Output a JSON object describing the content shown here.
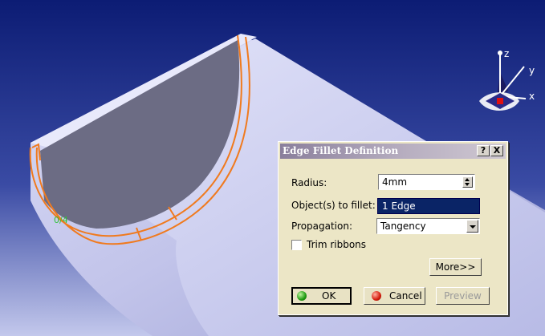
{
  "viewport": {
    "background_top": "#0d1f7a",
    "background_bottom": "#b6bde6",
    "part_color": "#c7c9ec",
    "highlight_color": "#f07a1e",
    "annotation_color": "#31c23a",
    "annotation_text": "0/4"
  },
  "compass": {
    "axis_x": "x",
    "axis_y": "y",
    "axis_z": "z"
  },
  "dialog": {
    "title": "Edge Fillet Definition",
    "help_label": "?",
    "close_label": "X",
    "radius": {
      "label": "Radius:",
      "value": "4mm"
    },
    "objects": {
      "label": "Object(s) to fillet:",
      "value": "1 Edge"
    },
    "propagation": {
      "label": "Propagation:",
      "value": "Tangency"
    },
    "trim_ribbons": {
      "label": "Trim ribbons",
      "checked": false
    },
    "more_label": "More>>",
    "ok_label": "OK",
    "cancel_label": "Cancel",
    "preview_label": "Preview"
  }
}
